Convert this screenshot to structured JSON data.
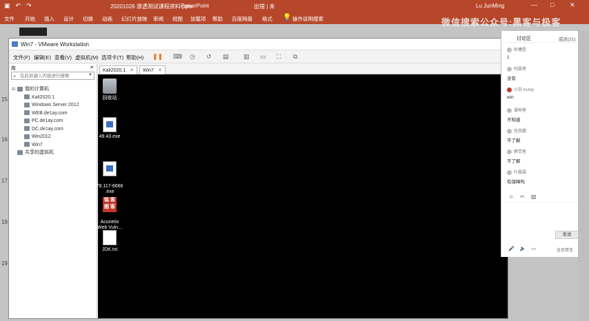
{
  "ppt": {
    "doc_title": "20201026 渗透测试课程资料.pptx",
    "app_name": "PowerPoint",
    "error_label": "出错 | 未",
    "user": "Lu JunMing",
    "qa_icons": [
      "save-icon",
      "undo-icon",
      "redo-icon"
    ],
    "tabs": [
      "文件",
      "开始",
      "插入",
      "设计",
      "切换",
      "动画",
      "幻灯片放映",
      "审阅",
      "视图",
      "加载项",
      "帮助",
      "百度网盘",
      "格式"
    ],
    "tell_me": "操作说明搜索",
    "win_buttons": [
      "—",
      "□",
      "✕"
    ]
  },
  "watermark": "微信搜索公众号:黑客与极客",
  "ruler": [
    "15",
    "16",
    "17",
    "18",
    "19"
  ],
  "vmware": {
    "title": "Win7 - VMware Workstation",
    "menu": [
      "文件(F)",
      "编辑(E)",
      "查看(V)",
      "虚拟机(M)",
      "选项卡(T)",
      "帮助(H)"
    ],
    "library_label": "库",
    "search_placeholder": "在此处键入内容进行搜索",
    "tree": [
      {
        "label": "我的计算机",
        "level": 0
      },
      {
        "label": "Kali2020.1",
        "level": 1
      },
      {
        "label": "Windows Server 2012",
        "level": 1
      },
      {
        "label": "WEB.de1ay.com",
        "level": 1
      },
      {
        "label": "PC.de1ay.com",
        "level": 1
      },
      {
        "label": "DC.de1ay.com",
        "level": 1
      },
      {
        "label": "Win2012",
        "level": 1
      },
      {
        "label": "Win7",
        "level": 1
      },
      {
        "label": "共享的虚拟机",
        "level": 0
      }
    ],
    "tabs": [
      {
        "label": "Kali2020.1"
      },
      {
        "label": "Win7"
      }
    ],
    "desktop_icons": [
      {
        "label": "回收站",
        "icon": "recycle-bin-icon"
      },
      {
        "label": "49.43.exe",
        "icon": "exe-icon"
      },
      {
        "label": "78.117-6666\n.exe",
        "icon": "exe-icon"
      },
      {
        "label": "Acunetix\nWeb Vuln...",
        "icon": "acunetix-icon"
      },
      {
        "label": "JDK.txt",
        "icon": "text-file-icon"
      }
    ],
    "acunetix_glyph": "铭 客\n图 客"
  },
  "chat": {
    "tab_discussion": "讨论区",
    "tab_members": "成员(21)",
    "messages": [
      {
        "who": "卧槽是",
        "text": "1"
      },
      {
        "who": "阿震哥",
        "text": "没有"
      },
      {
        "who": "小白 trump",
        "text": "win"
      },
      {
        "who": "凝神者",
        "text": "不知道"
      },
      {
        "who": "任我趣",
        "text": "不了解"
      },
      {
        "who": "察觉者",
        "text": "不了解"
      },
      {
        "who": "叶晨霖",
        "text": "有保障吗"
      }
    ],
    "send_label": "发送",
    "footer_text": "全员禁言"
  }
}
